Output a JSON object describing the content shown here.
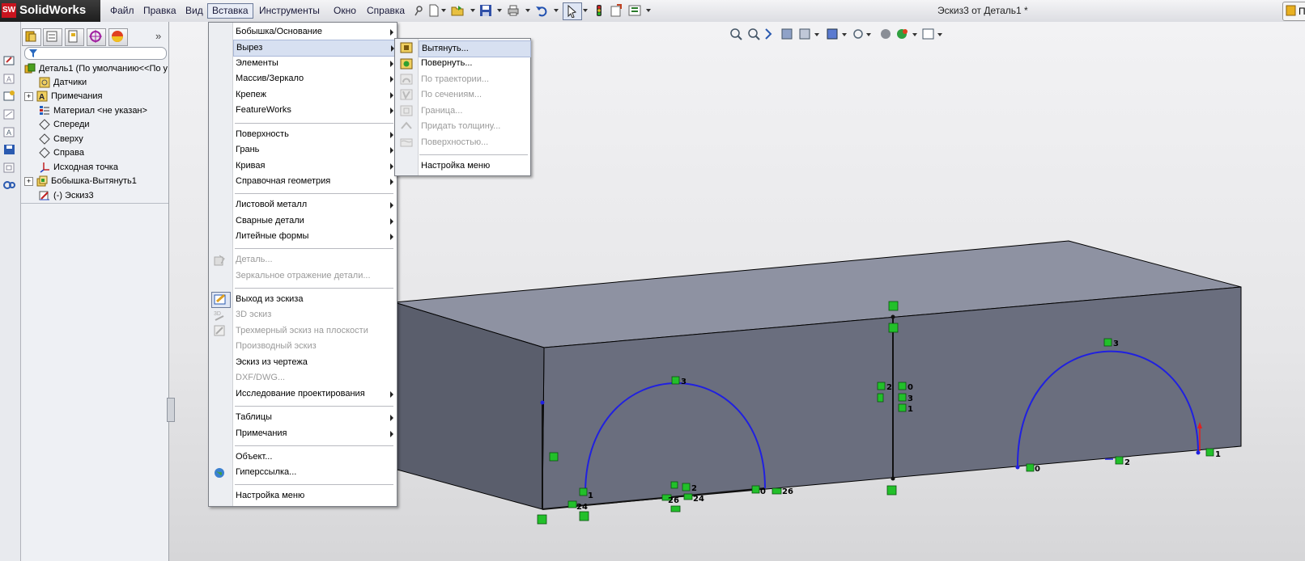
{
  "app": {
    "logo_text": "SolidWorks",
    "logo_badge": "SW",
    "window_title": "Эскиз3 от Деталь1 *",
    "help_label": "П"
  },
  "menubar": {
    "items": [
      "Файл",
      "Правка",
      "Вид",
      "Вставка",
      "Инструменты",
      "Окно",
      "Справка"
    ],
    "active": "Вставка"
  },
  "feature_tree": {
    "items": [
      {
        "label": "Деталь1  (По умолчанию<<По у",
        "icon": "part-icon",
        "expandable": false,
        "indent": 0
      },
      {
        "label": "Датчики",
        "icon": "sensors-icon",
        "expandable": false,
        "indent": 1
      },
      {
        "label": "Примечания",
        "icon": "annotations-icon",
        "expandable": true,
        "indent": 1
      },
      {
        "label": "Материал <не указан>",
        "icon": "material-icon",
        "expandable": false,
        "indent": 1
      },
      {
        "label": "Спереди",
        "icon": "plane-icon",
        "expandable": false,
        "indent": 1
      },
      {
        "label": "Сверху",
        "icon": "plane-icon",
        "expandable": false,
        "indent": 1
      },
      {
        "label": "Справа",
        "icon": "plane-icon",
        "expandable": false,
        "indent": 1
      },
      {
        "label": "Исходная точка",
        "icon": "origin-icon",
        "expandable": false,
        "indent": 1
      },
      {
        "label": "Бобышка-Вытянуть1",
        "icon": "boss-extrude-icon",
        "expandable": true,
        "indent": 1
      },
      {
        "label": "(-) Эскиз3",
        "icon": "sketch-icon",
        "expandable": false,
        "indent": 1
      }
    ]
  },
  "insert_menu": {
    "items": [
      {
        "label": "Бобышка/Основание",
        "submenu": true,
        "disabled": false
      },
      {
        "label": "Вырез",
        "submenu": true,
        "disabled": false,
        "highlighted": true
      },
      {
        "label": "Элементы",
        "submenu": true,
        "disabled": false
      },
      {
        "label": "Массив/Зеркало",
        "submenu": true,
        "disabled": false
      },
      {
        "label": "Крепеж",
        "submenu": true,
        "disabled": false
      },
      {
        "label": "FeatureWorks",
        "submenu": true,
        "disabled": false
      },
      {
        "label": "Поверхность",
        "submenu": true,
        "disabled": false
      },
      {
        "label": "Грань",
        "submenu": true,
        "disabled": false
      },
      {
        "label": "Кривая",
        "submenu": true,
        "disabled": false
      },
      {
        "label": "Справочная геометрия",
        "submenu": true,
        "disabled": false
      },
      {
        "label": "Листовой металл",
        "submenu": true,
        "disabled": false
      },
      {
        "label": "Сварные детали",
        "submenu": true,
        "disabled": false
      },
      {
        "label": "Литейные формы",
        "submenu": true,
        "disabled": false
      },
      {
        "label": "Деталь...",
        "submenu": false,
        "disabled": true
      },
      {
        "label": "Зеркальное отражение детали...",
        "submenu": false,
        "disabled": true
      },
      {
        "label": "Выход из эскиза",
        "submenu": false,
        "disabled": false
      },
      {
        "label": "3D эскиз",
        "submenu": false,
        "disabled": true
      },
      {
        "label": "Трехмерный эскиз на плоскости",
        "submenu": false,
        "disabled": true
      },
      {
        "label": "Производный эскиз",
        "submenu": false,
        "disabled": true
      },
      {
        "label": "Эскиз из чертежа",
        "submenu": false,
        "disabled": false
      },
      {
        "label": "DXF/DWG...",
        "submenu": false,
        "disabled": true
      },
      {
        "label": "Исследование проектирования",
        "submenu": true,
        "disabled": false
      },
      {
        "label": "Таблицы",
        "submenu": true,
        "disabled": false
      },
      {
        "label": "Примечания",
        "submenu": true,
        "disabled": false
      },
      {
        "label": "Объект...",
        "submenu": false,
        "disabled": false
      },
      {
        "label": "Гиперссылка...",
        "submenu": false,
        "disabled": false
      },
      {
        "label": "Настройка меню",
        "submenu": false,
        "disabled": false
      }
    ]
  },
  "cut_submenu": {
    "items": [
      {
        "label": "Вытянуть...",
        "disabled": false,
        "highlighted": true
      },
      {
        "label": "Повернуть...",
        "disabled": false
      },
      {
        "label": "По траектории...",
        "disabled": true
      },
      {
        "label": "По сечениям...",
        "disabled": true
      },
      {
        "label": "Граница...",
        "disabled": true
      },
      {
        "label": "Придать толщину...",
        "disabled": true
      },
      {
        "label": "Поверхностью...",
        "disabled": true
      },
      {
        "label": "Настройка меню",
        "disabled": false
      }
    ]
  },
  "sketch_labels": [
    "3",
    "1",
    "24",
    "26",
    "2",
    "24",
    "0",
    "26",
    "2",
    "0",
    "3",
    "1",
    "3",
    "0",
    "2",
    "1"
  ],
  "colors": {
    "accent": "#2020e0",
    "relation_green": "#22c02a",
    "part_face": "#6a6e7e"
  }
}
